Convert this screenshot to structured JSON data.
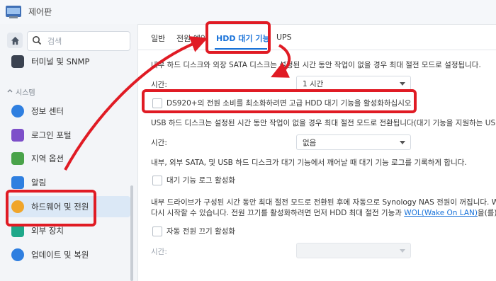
{
  "window": {
    "title": "제어판"
  },
  "search": {
    "placeholder": "검색"
  },
  "sidebar": {
    "group_label": "시스템",
    "items": [
      {
        "label": "터미널 및 SNMP",
        "color": "#3a4250"
      },
      {
        "label": "정보 센터",
        "color": "#2f7fe0"
      },
      {
        "label": "로그인 포털",
        "color": "#7d4fc9"
      },
      {
        "label": "지역 옵션",
        "color": "#4aa34a"
      },
      {
        "label": "알림",
        "color": "#2f7fe0"
      },
      {
        "label": "하드웨어 및 전원",
        "color": "#f0a52a"
      },
      {
        "label": "외부 장치",
        "color": "#1fa88a"
      },
      {
        "label": "업데이트 및 복원",
        "color": "#2f7fe0"
      }
    ],
    "active_item": "하드웨어 및 전원"
  },
  "tabs": [
    "일반",
    "전원 예약",
    "HDD 대기 기능",
    "UPS"
  ],
  "active_tab": "HDD 대기 기능",
  "content": {
    "internal_desc": "내부 하드 디스크와 외장 SATA 디스크는 설정된 시간 동안 작업이 없을 경우 최대 절전 모드로 설정됩니다.",
    "time_label_1": "시간:",
    "time_value_1": "1 시간",
    "advanced_checkbox_label": "DS920+의 전원 소비를 최소화하려면 고급 HDD 대기 기능을 활성화하십시오",
    "usb_desc": "USB 하드 디스크는 설정된 시간 동안 작업이 없을 경우 최대 절전 모드로 전환됩니다(대기 기능을 지원하는 USB 장",
    "time_label_2": "시간:",
    "time_value_2": "없음",
    "log_desc": "내부, 외부 SATA, 및 USB 하드 디스크가 대기 기능에서 깨어날 때 대기 기능 로그를 기록하게 합니다.",
    "log_checkbox_label": "대기 기능 로그 활성화",
    "auto_desc_1": "내부 드라이브가 구성된 시간 동안 최대 절전 모드로 전환된 후에 자동으로 Synology NAS 전원이 꺼집니다. WOL",
    "auto_desc_2a": "다시 시작할 수 있습니다. 전원 끄기를 활성화하려면 먼저 HDD 최대 절전 기능과 ",
    "auto_desc_link": "WOL(Wake On LAN)",
    "auto_desc_2b": "을(를) 활성",
    "auto_off_label": "자동 전원 끄기 활성화",
    "time_label_3": "시간:",
    "time_value_3": ""
  },
  "colors": {
    "accent": "#1a73d9",
    "annotation": "#e01b24"
  }
}
